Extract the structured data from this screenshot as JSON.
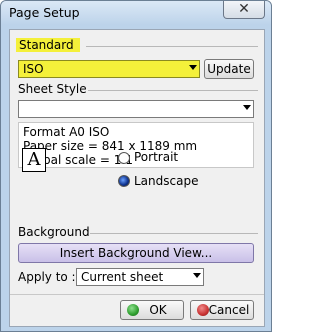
{
  "window": {
    "title": "Page Setup",
    "close_glyph": "✕"
  },
  "standard": {
    "label": "Standard",
    "value": "ISO",
    "update_label": "Update"
  },
  "sheet_style": {
    "label": "Sheet Style",
    "value": ""
  },
  "format_info": {
    "lines": [
      "Format A0 ISO",
      "Paper size = 841 x 1189 mm",
      "Global scale = 1:1"
    ]
  },
  "orientation": {
    "icon": "font-a-icon",
    "icon_text": "A",
    "portrait_label": "Portrait",
    "landscape_label": "Landscape",
    "selected": "Landscape"
  },
  "background": {
    "label": "Background",
    "insert_button_label": "Insert Background View..."
  },
  "apply_to": {
    "label": "Apply to :",
    "value": "Current sheet"
  },
  "footer": {
    "ok_label": "OK",
    "cancel_label": "Cancel"
  },
  "colors": {
    "highlight": "#f4f03a",
    "ok_icon": "#2e9e2e",
    "cancel_icon": "#c83232"
  }
}
